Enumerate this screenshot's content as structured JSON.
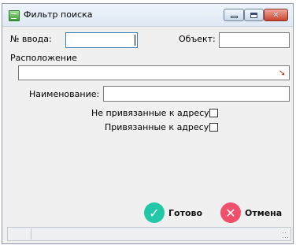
{
  "window": {
    "title": "Фильтр поиска"
  },
  "form": {
    "input_no_label": "№ ввода:",
    "input_no_value": "",
    "object_label": "Объект:",
    "object_value": "",
    "location_label": "Расположение",
    "location_value": "",
    "name_label": "Наименование:",
    "name_value": "",
    "not_linked_label": "Не привязанные к адресу",
    "not_linked_checked": false,
    "linked_label": "Привязанные к адресу",
    "linked_checked": false
  },
  "buttons": {
    "ok_label": "Готово",
    "cancel_label": "Отмена"
  },
  "colors": {
    "ok": "#21c7a6",
    "cancel": "#f0506c"
  }
}
